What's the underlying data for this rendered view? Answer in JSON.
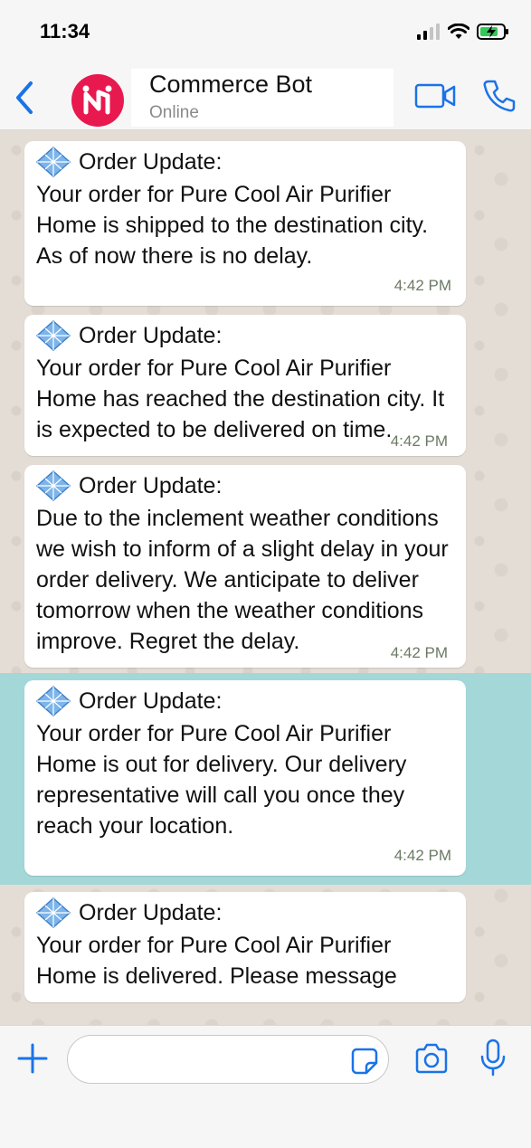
{
  "status_bar": {
    "time": "11:34"
  },
  "header": {
    "title": "Commerce Bot",
    "status": "Online",
    "back_icon": "chevron-left-icon",
    "video_icon": "video-camera-icon",
    "call_icon": "phone-icon"
  },
  "messages": [
    {
      "title": "Order Update:",
      "body": "Your order for Pure Cool Air Purifier Home is shipped to the destination city. As of now there is no delay.",
      "time": "4:42 PM"
    },
    {
      "title": "Order Update:",
      "body": "Your order for Pure Cool Air Purifier Home has reached the destination city. It is expected to be delivered on time.",
      "time": "4:42 PM"
    },
    {
      "title": "Order Update:",
      "body": "Due to the inclement weather conditions we wish to inform of a slight delay in your order delivery. We anticipate to deliver tomorrow when the weather conditions improve. Regret the delay.",
      "time": "4:42 PM"
    },
    {
      "title": "Order Update:",
      "body": "Your order for Pure Cool Air Purifier Home is out for delivery. Our delivery representative will call you once they reach your location.",
      "time": "4:42 PM"
    },
    {
      "title": "Order Update:",
      "body": "Your order for Pure Cool Air Purifier Home is delivered. Please message",
      "time": ""
    }
  ],
  "composer": {
    "input_value": "",
    "plus_icon": "plus-icon",
    "sticker_icon": "sticker-icon",
    "camera_icon": "camera-icon",
    "mic_icon": "microphone-icon"
  },
  "colors": {
    "accent": "#1a73e8",
    "avatar": "#e8194f",
    "highlight": "#a3d7d8",
    "chat_background": "#e4ddd5"
  }
}
